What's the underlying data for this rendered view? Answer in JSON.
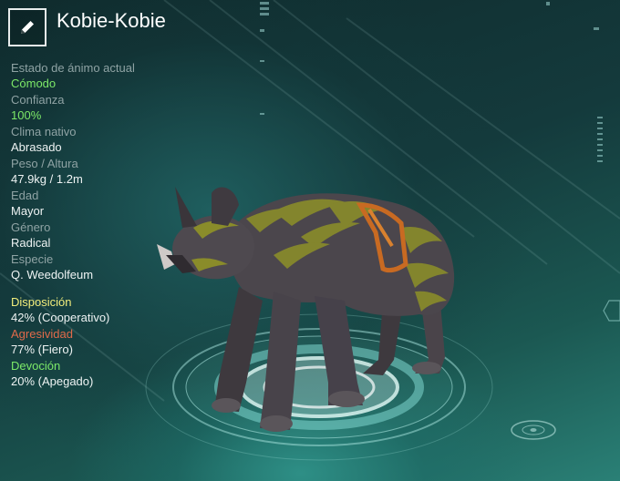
{
  "title": "Kobie-Kobie",
  "stats": [
    {
      "label": "Estado de ánimo actual",
      "value": "Cómodo"
    },
    {
      "label": "Confianza",
      "value": "100%"
    },
    {
      "label": "Clima nativo",
      "value": "Abrasado"
    },
    {
      "label": "Peso / Altura",
      "value": "47.9kg / 1.2m"
    },
    {
      "label": "Edad",
      "value": "Mayor"
    },
    {
      "label": "Género",
      "value": "Radical"
    },
    {
      "label": "Especie",
      "value": "Q. Weedolfeum"
    }
  ],
  "temperament": [
    {
      "label": "Disposición",
      "value": "42% (Cooperativo)"
    },
    {
      "label": "Agresividad",
      "value": "77% (Fiero)"
    },
    {
      "label": "Devoción",
      "value": "20% (Apegado)"
    }
  ],
  "icons": {
    "edit": "pencil-icon"
  },
  "colors": {
    "positive": "#7ce868",
    "disposition": "#f2ed7c",
    "aggression": "#e06a4a"
  }
}
